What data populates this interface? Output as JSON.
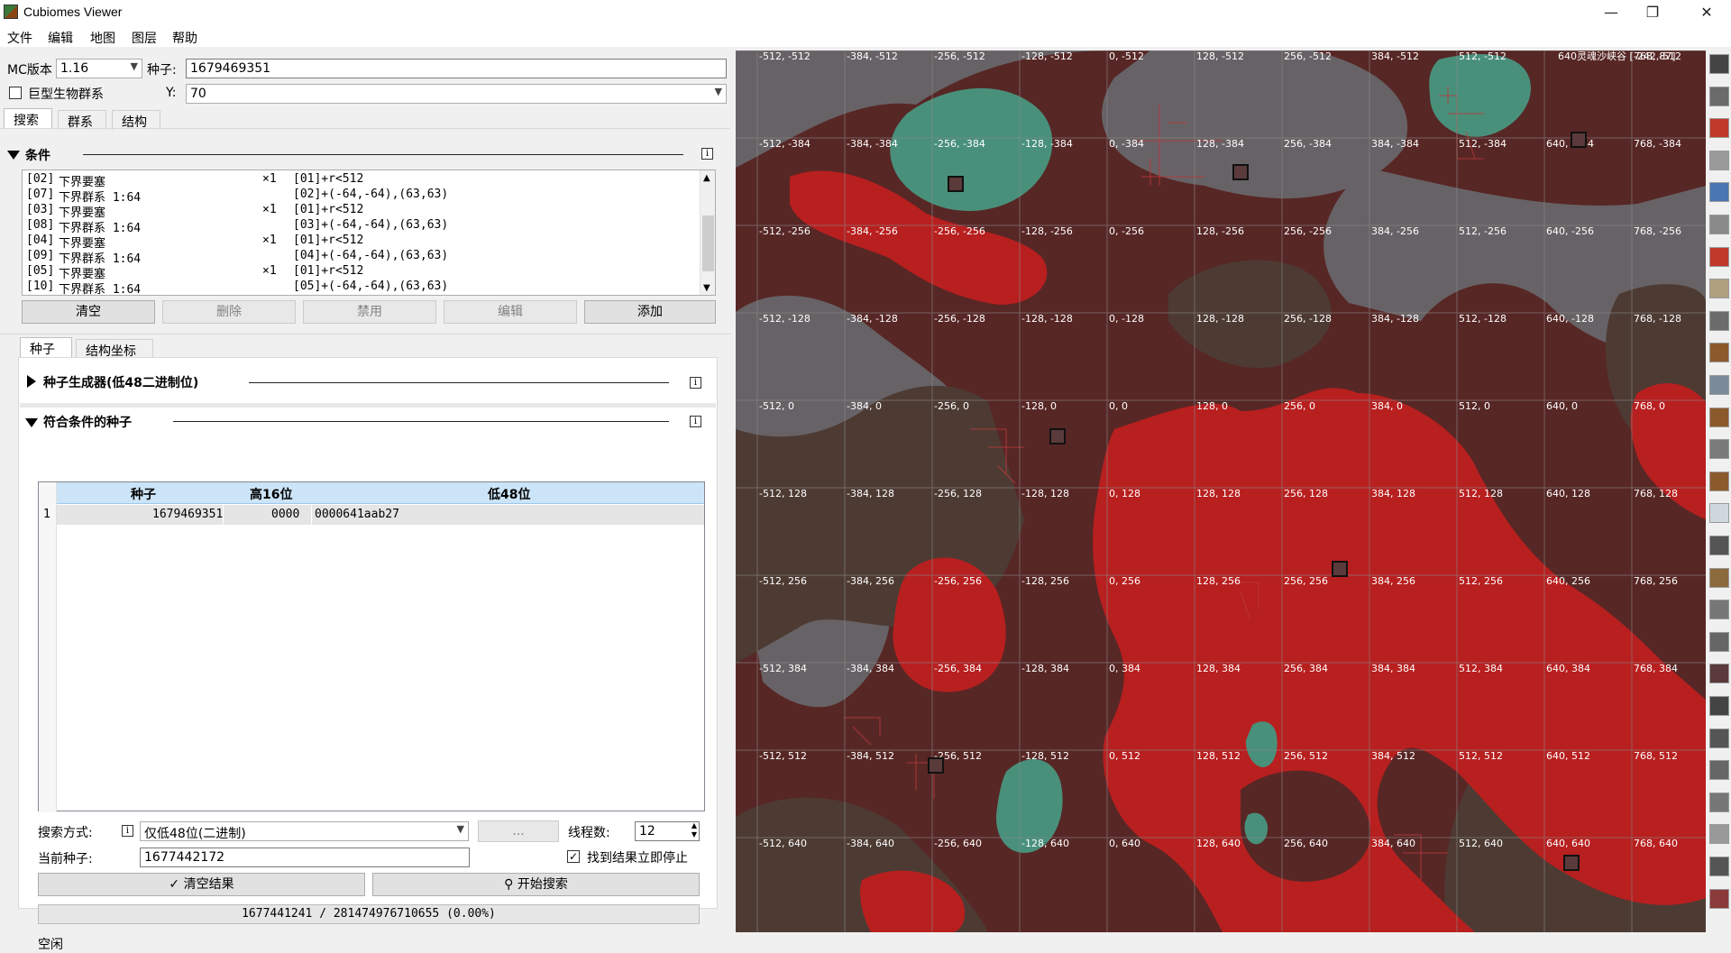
{
  "window": {
    "title": "Cubiomes Viewer",
    "minimize": "—",
    "maximize": "❐",
    "close": "✕"
  },
  "menu": [
    "文件",
    "编辑",
    "地图",
    "图层",
    "帮助"
  ],
  "settings": {
    "mc_label": "MC版本",
    "mc_value": "1.16",
    "seed_label": "种子:",
    "seed_value": "1679469351",
    "large_biomes_label": "巨型生物群系",
    "y_label": "Y:",
    "y_value": "70"
  },
  "main_tabs": [
    "搜索",
    "群系",
    "结构"
  ],
  "conditions": {
    "title": "条件",
    "rows": [
      {
        "id": "[02]",
        "name": "下界要塞",
        "count": "×1",
        "expr": "[01]+r<512"
      },
      {
        "id": "[07]",
        "name": "下界群系 1:64",
        "count": "",
        "expr": "[02]+(-64,-64),(63,63)"
      },
      {
        "id": "[03]",
        "name": "下界要塞",
        "count": "×1",
        "expr": "[01]+r<512"
      },
      {
        "id": "[08]",
        "name": "下界群系 1:64",
        "count": "",
        "expr": "[03]+(-64,-64),(63,63)"
      },
      {
        "id": "[04]",
        "name": "下界要塞",
        "count": "×1",
        "expr": "[01]+r<512"
      },
      {
        "id": "[09]",
        "name": "下界群系 1:64",
        "count": "",
        "expr": "[04]+(-64,-64),(63,63)"
      },
      {
        "id": "[05]",
        "name": "下界要塞",
        "count": "×1",
        "expr": "[01]+r<512"
      },
      {
        "id": "[10]",
        "name": "下界群系 1:64",
        "count": "",
        "expr": "[05]+(-64,-64),(63,63)"
      }
    ],
    "buttons": {
      "clear": "清空",
      "delete": "删除",
      "disable": "禁用",
      "edit": "编辑",
      "add": "添加"
    }
  },
  "sub_tabs": [
    "种子",
    "结构坐标"
  ],
  "seed_generator": {
    "title": "种子生成器(低48二进制位)"
  },
  "matches": {
    "title": "符合条件的种子",
    "columns": [
      "种子",
      "高16位",
      "低48位"
    ],
    "rows": [
      {
        "num": "1",
        "seed": "1679469351",
        "high": "0000",
        "low": "0000641aab27"
      }
    ]
  },
  "search": {
    "method_label": "搜索方式:",
    "method_value": "仅低48位(二进制)",
    "dots_button": "...",
    "threads_label": "线程数:",
    "threads_value": "12",
    "current_seed_label": "当前种子:",
    "current_seed_value": "1677442172",
    "stop_label": "找到结果立即停止",
    "clear_results": "清空结果",
    "start_search": "开始搜索",
    "progress_text": "1677441241 / 281474976710655 (0.00%)",
    "progress": 0.0,
    "status": "空闲"
  },
  "map": {
    "cursor_info": "640灵魂沙峡谷 [-242,87]",
    "colors": {
      "nether_wastes": "#572725",
      "crimson_forest": "#b81f1f",
      "warped_forest": "#49907b",
      "basalt_deltas": "#676266",
      "soul_sand_valley": "#4d3b33"
    },
    "x_labels": [
      "-512",
      "-384",
      "-256",
      "-128",
      "0",
      "128",
      "256",
      "384",
      "512",
      "640",
      "768"
    ],
    "z_labels": [
      "-512",
      "-384",
      "-256",
      "-128",
      "0",
      "128",
      "256",
      "384",
      "512",
      "640"
    ]
  },
  "toolbar_icons": [
    "compass-icon",
    "slime-icon",
    "nether-icon",
    "end-icon",
    "grid-icon",
    "stone-icon",
    "village-icon",
    "desert-temple-icon",
    "jungle-temple-icon",
    "witch-hut-icon",
    "monument-icon",
    "mansion-icon",
    "outpost-icon",
    "shipwreck-icon",
    "igloo-icon",
    "ruined-portal-icon",
    "mineshaft-icon",
    "ancient-city-icon",
    "treasure-icon",
    "fortress-icon",
    "bastion-icon",
    "end-city-icon",
    "gateway-icon",
    "stronghold-icon",
    "spawn-icon",
    "pickaxe-icon",
    "layer-icon"
  ]
}
